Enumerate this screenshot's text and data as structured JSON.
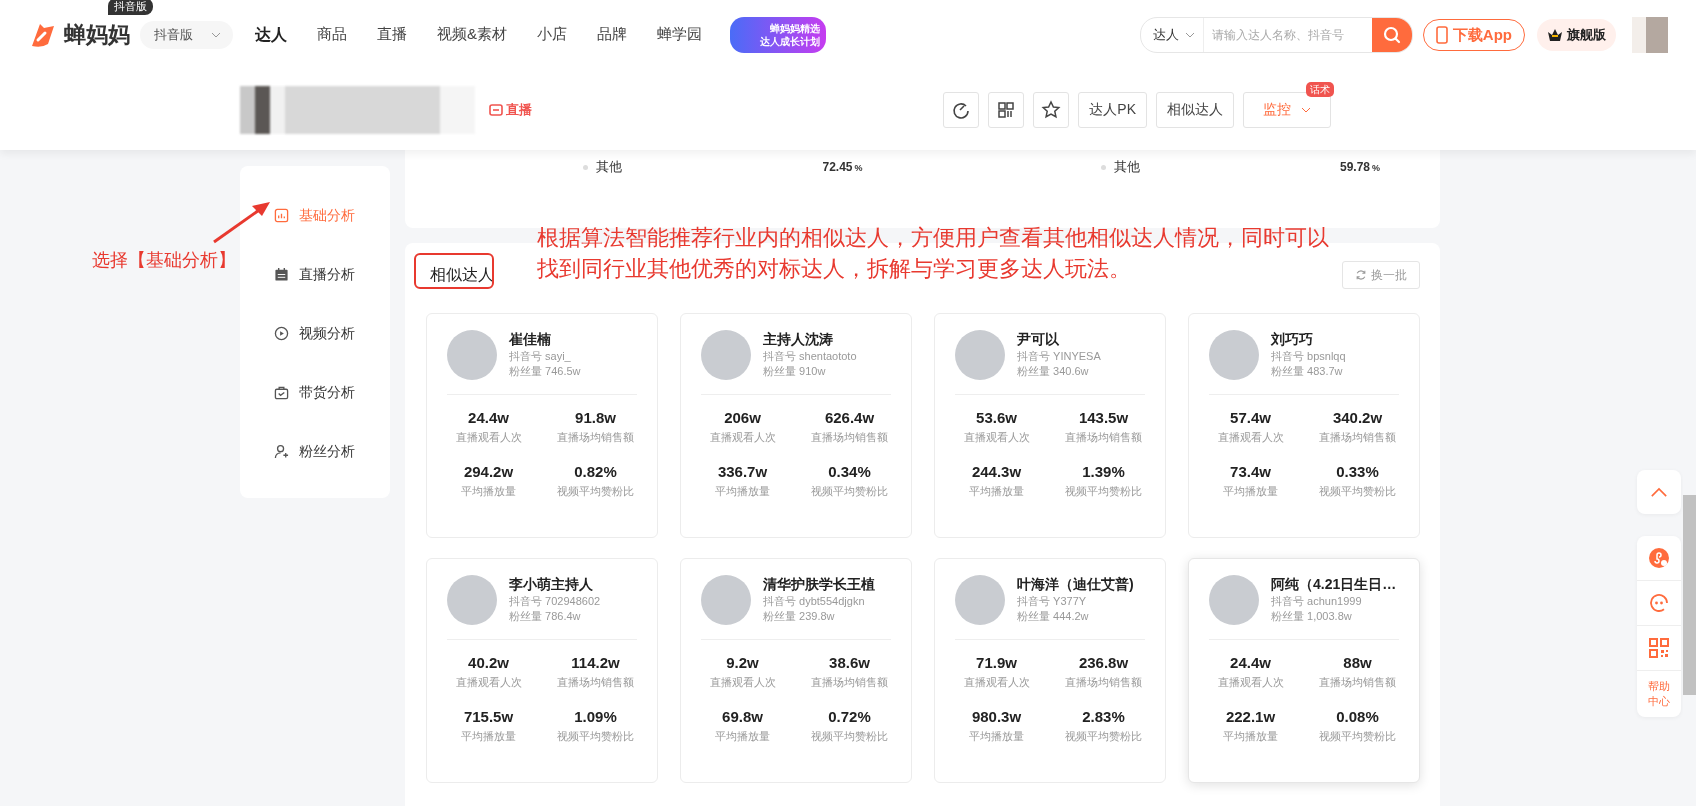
{
  "nav": {
    "logo": "蝉妈妈",
    "logo_badge": "抖音版",
    "platform": "抖音版",
    "tabs": [
      {
        "label": "达人",
        "selected": true
      },
      {
        "label": "商品",
        "selected": false
      },
      {
        "label": "直播",
        "selected": false
      },
      {
        "label": "视频&素材",
        "selected": false
      },
      {
        "label": "小店",
        "selected": false
      },
      {
        "label": "品牌",
        "selected": false
      },
      {
        "label": "蝉学园",
        "selected": false
      }
    ],
    "promo": [
      "蝉妈妈精选",
      "达人成长计划"
    ],
    "search": {
      "scope": "达人",
      "placeholder": "请输入达人名称、抖音号"
    },
    "download": "下载App",
    "vip": "旗舰版"
  },
  "header": {
    "live_badge": "直播",
    "actions": [
      {
        "kind": "refresh"
      },
      {
        "kind": "qr"
      },
      {
        "kind": "star"
      },
      {
        "kind": "text",
        "label": "达人PK"
      },
      {
        "kind": "text",
        "label": "相似达人"
      }
    ],
    "monitor": {
      "label": "监控",
      "badge": "话术"
    }
  },
  "prev_card": [
    {
      "label": "其他",
      "value": "72.45",
      "unit": "%"
    },
    {
      "label": "其他",
      "value": "59.78",
      "unit": "%"
    }
  ],
  "sidebar": {
    "items": [
      {
        "label": "基础分析",
        "selected": true
      },
      {
        "label": "直播分析",
        "selected": false
      },
      {
        "label": "视频分析",
        "selected": false
      },
      {
        "label": "带货分析",
        "selected": false
      },
      {
        "label": "粉丝分析",
        "selected": false
      }
    ]
  },
  "similar": {
    "title": "相似达人",
    "refresh": "换一批",
    "creators": [
      {
        "name": "崔佳楠",
        "douyin_id": "抖音号 sayi_",
        "fans": "粉丝量 746.5w",
        "hovered": false,
        "stats": [
          {
            "value": "24.4w",
            "label": "直播观看人次"
          },
          {
            "value": "91.8w",
            "label": "直播场均销售额"
          },
          {
            "value": "294.2w",
            "label": "平均播放量"
          },
          {
            "value": "0.82%",
            "label": "视频平均赞粉比"
          }
        ]
      },
      {
        "name": "主持人沈涛",
        "douyin_id": "抖音号 shentaototo",
        "fans": "粉丝量 910w",
        "hovered": false,
        "stats": [
          {
            "value": "206w",
            "label": "直播观看人次"
          },
          {
            "value": "626.4w",
            "label": "直播场均销售额"
          },
          {
            "value": "336.7w",
            "label": "平均播放量"
          },
          {
            "value": "0.34%",
            "label": "视频平均赞粉比"
          }
        ]
      },
      {
        "name": "尹可以",
        "douyin_id": "抖音号 YINYESA",
        "fans": "粉丝量 340.6w",
        "hovered": false,
        "stats": [
          {
            "value": "53.6w",
            "label": "直播观看人次"
          },
          {
            "value": "143.5w",
            "label": "直播场均销售额"
          },
          {
            "value": "244.3w",
            "label": "平均播放量"
          },
          {
            "value": "1.39%",
            "label": "视频平均赞粉比"
          }
        ]
      },
      {
        "name": "刘巧巧",
        "douyin_id": "抖音号 bpsnlqq",
        "fans": "粉丝量 483.7w",
        "hovered": false,
        "stats": [
          {
            "value": "57.4w",
            "label": "直播观看人次"
          },
          {
            "value": "340.2w",
            "label": "直播场均销售额"
          },
          {
            "value": "73.4w",
            "label": "平均播放量"
          },
          {
            "value": "0.33%",
            "label": "视频平均赞粉比"
          }
        ]
      },
      {
        "name": "李小萌主持人",
        "douyin_id": "抖音号 702948602",
        "fans": "粉丝量 786.4w",
        "hovered": false,
        "stats": [
          {
            "value": "40.2w",
            "label": "直播观看人次"
          },
          {
            "value": "114.2w",
            "label": "直播场均销售额"
          },
          {
            "value": "715.5w",
            "label": "平均播放量"
          },
          {
            "value": "1.09%",
            "label": "视频平均赞粉比"
          }
        ]
      },
      {
        "name": "清华护肤学长王植",
        "douyin_id": "抖音号 dybt554djgkn",
        "fans": "粉丝量 239.8w",
        "hovered": false,
        "stats": [
          {
            "value": "9.2w",
            "label": "直播观看人次"
          },
          {
            "value": "38.6w",
            "label": "直播场均销售额"
          },
          {
            "value": "69.8w",
            "label": "平均播放量"
          },
          {
            "value": "0.72%",
            "label": "视频平均赞粉比"
          }
        ]
      },
      {
        "name": "叶海洋（迪仕艾普)",
        "douyin_id": "抖音号 Y377Y",
        "fans": "粉丝量 444.2w",
        "hovered": false,
        "stats": [
          {
            "value": "71.9w",
            "label": "直播观看人次"
          },
          {
            "value": "236.8w",
            "label": "直播场均销售额"
          },
          {
            "value": "980.3w",
            "label": "平均播放量"
          },
          {
            "value": "2.83%",
            "label": "视频平均赞粉比"
          }
        ]
      },
      {
        "name": "阿纯（4.21日生日…",
        "douyin_id": "抖音号 achun1999",
        "fans": "粉丝量 1,003.8w",
        "hovered": true,
        "stats": [
          {
            "value": "24.4w",
            "label": "直播观看人次"
          },
          {
            "value": "88w",
            "label": "直播场均销售额"
          },
          {
            "value": "222.1w",
            "label": "平均播放量"
          },
          {
            "value": "0.08%",
            "label": "视频平均赞粉比"
          }
        ]
      }
    ]
  },
  "annotations": {
    "pointer_label": "选择【基础分析】",
    "note": "根据算法智能推荐行业内的相似达人，方便用户查看其他相似达人情况，同时可以找到同行业其他优秀的对标达人，拆解与学习更多达人玩法。"
  },
  "float_tools": {
    "help": "帮助中心"
  }
}
